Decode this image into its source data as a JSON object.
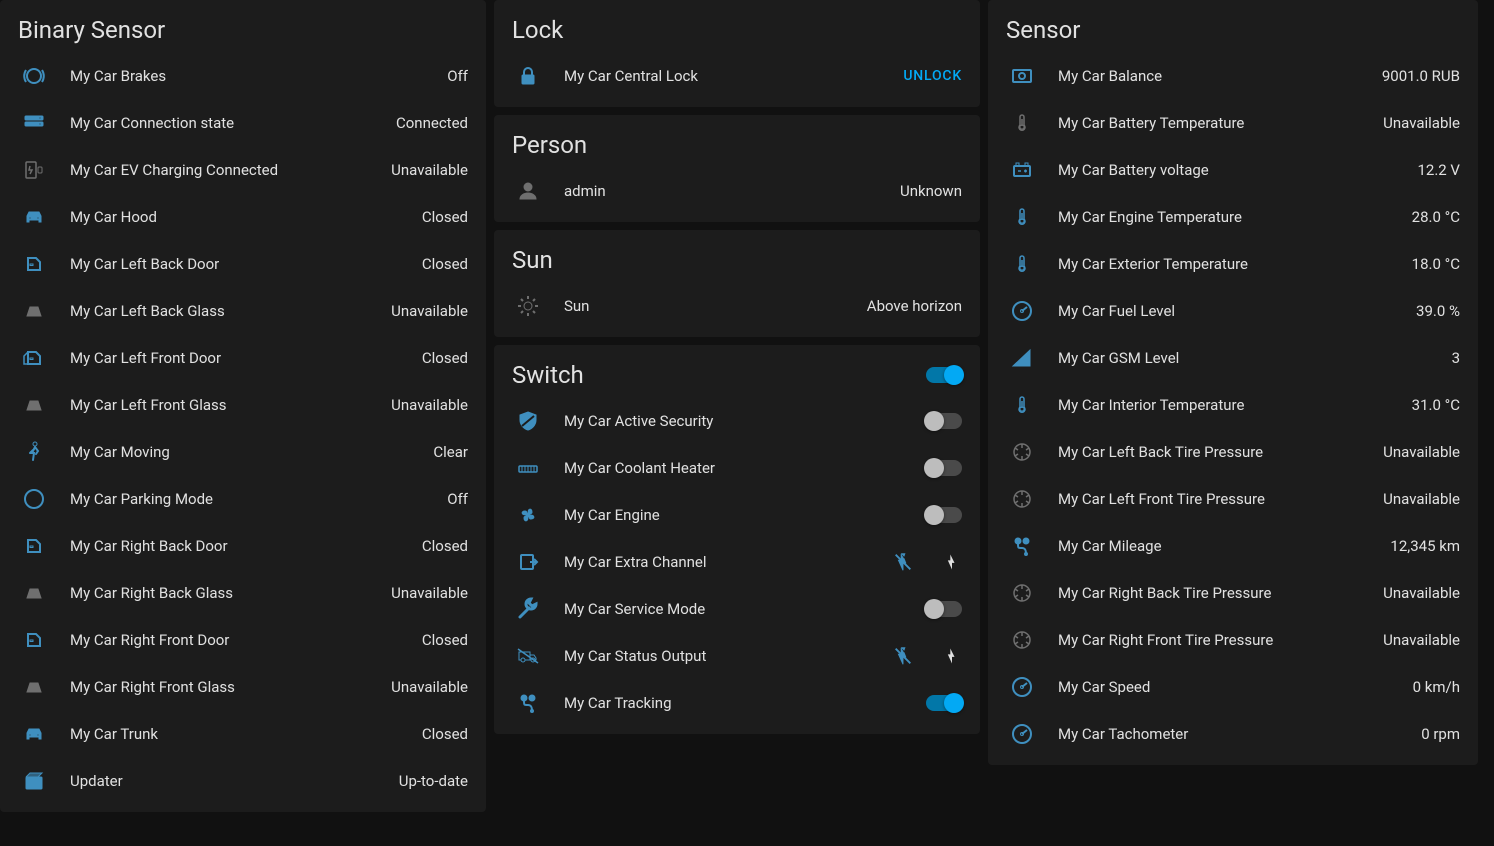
{
  "binary_sensor": {
    "title": "Binary Sensor",
    "items": [
      {
        "icon": "brake",
        "label": "My Car Brakes",
        "value": "Off",
        "color": "blue"
      },
      {
        "icon": "connection",
        "label": "My Car Connection state",
        "value": "Connected",
        "color": "blue"
      },
      {
        "icon": "ev",
        "label": "My Car EV Charging Connected",
        "value": "Unavailable",
        "color": "grey"
      },
      {
        "icon": "car",
        "label": "My Car Hood",
        "value": "Closed",
        "color": "blue"
      },
      {
        "icon": "door",
        "label": "My Car Left Back Door",
        "value": "Closed",
        "color": "blue"
      },
      {
        "icon": "glass",
        "label": "My Car Left Back Glass",
        "value": "Unavailable",
        "color": "grey"
      },
      {
        "icon": "door-open",
        "label": "My Car Left Front Door",
        "value": "Closed",
        "color": "blue"
      },
      {
        "icon": "glass",
        "label": "My Car Left Front Glass",
        "value": "Unavailable",
        "color": "grey"
      },
      {
        "icon": "walk",
        "label": "My Car Moving",
        "value": "Clear",
        "color": "blue"
      },
      {
        "icon": "parking",
        "label": "My Car Parking Mode",
        "value": "Off",
        "color": "blue"
      },
      {
        "icon": "door",
        "label": "My Car Right Back Door",
        "value": "Closed",
        "color": "blue"
      },
      {
        "icon": "glass",
        "label": "My Car Right Back Glass",
        "value": "Unavailable",
        "color": "grey"
      },
      {
        "icon": "door",
        "label": "My Car Right Front Door",
        "value": "Closed",
        "color": "blue"
      },
      {
        "icon": "glass",
        "label": "My Car Right Front Glass",
        "value": "Unavailable",
        "color": "grey"
      },
      {
        "icon": "car",
        "label": "My Car Trunk",
        "value": "Closed",
        "color": "blue"
      },
      {
        "icon": "package",
        "label": "Updater",
        "value": "Up-to-date",
        "color": "blue"
      }
    ]
  },
  "lock": {
    "title": "Lock",
    "items": [
      {
        "icon": "lock",
        "label": "My Car Central Lock",
        "action": "UNLOCK",
        "color": "blue"
      }
    ]
  },
  "person": {
    "title": "Person",
    "items": [
      {
        "icon": "person",
        "label": "admin",
        "value": "Unknown",
        "color": "grey"
      }
    ]
  },
  "sun": {
    "title": "Sun",
    "items": [
      {
        "icon": "sun",
        "label": "Sun",
        "value": "Above horizon",
        "color": "grey"
      }
    ]
  },
  "switch": {
    "title": "Switch",
    "master_on": true,
    "items": [
      {
        "icon": "shield",
        "label": "My Car Active Security",
        "type": "toggle",
        "on": false,
        "color": "blue"
      },
      {
        "icon": "radiator",
        "label": "My Car Coolant Heater",
        "type": "toggle",
        "on": false,
        "color": "blue"
      },
      {
        "icon": "fan",
        "label": "My Car Engine",
        "type": "toggle",
        "on": false,
        "color": "blue"
      },
      {
        "icon": "export",
        "label": "My Car Extra Channel",
        "type": "flash",
        "color": "blue"
      },
      {
        "icon": "wrench",
        "label": "My Car Service Mode",
        "type": "toggle",
        "on": false,
        "color": "blue"
      },
      {
        "icon": "truck",
        "label": "My Car Status Output",
        "type": "flash",
        "color": "blue"
      },
      {
        "icon": "map-marker",
        "label": "My Car Tracking",
        "type": "toggle",
        "on": true,
        "color": "blue"
      }
    ]
  },
  "sensor": {
    "title": "Sensor",
    "items": [
      {
        "icon": "cash",
        "label": "My Car Balance",
        "value": "9001.0 RUB",
        "color": "blue"
      },
      {
        "icon": "thermometer",
        "label": "My Car Battery Temperature",
        "value": "Unavailable",
        "color": "grey"
      },
      {
        "icon": "battery",
        "label": "My Car Battery voltage",
        "value": "12.2 V",
        "color": "blue"
      },
      {
        "icon": "thermometer",
        "label": "My Car Engine Temperature",
        "value": "28.0 °C",
        "color": "blue"
      },
      {
        "icon": "thermometer",
        "label": "My Car Exterior Temperature",
        "value": "18.0 °C",
        "color": "blue"
      },
      {
        "icon": "gauge",
        "label": "My Car Fuel Level",
        "value": "39.0 %",
        "color": "blue"
      },
      {
        "icon": "signal",
        "label": "My Car GSM Level",
        "value": "3",
        "color": "blue"
      },
      {
        "icon": "thermometer",
        "label": "My Car Interior Temperature",
        "value": "31.0 °C",
        "color": "blue"
      },
      {
        "icon": "tire",
        "label": "My Car Left Back Tire Pressure",
        "value": "Unavailable",
        "color": "grey"
      },
      {
        "icon": "tire",
        "label": "My Car Left Front Tire Pressure",
        "value": "Unavailable",
        "color": "grey"
      },
      {
        "icon": "map-marker",
        "label": "My Car Mileage",
        "value": "12,345 km",
        "color": "blue"
      },
      {
        "icon": "tire",
        "label": "My Car Right Back Tire Pressure",
        "value": "Unavailable",
        "color": "grey"
      },
      {
        "icon": "tire",
        "label": "My Car Right Front Tire Pressure",
        "value": "Unavailable",
        "color": "grey"
      },
      {
        "icon": "gauge",
        "label": "My Car Speed",
        "value": "0 km/h",
        "color": "blue"
      },
      {
        "icon": "gauge",
        "label": "My Car Tachometer",
        "value": "0 rpm",
        "color": "blue"
      }
    ]
  }
}
